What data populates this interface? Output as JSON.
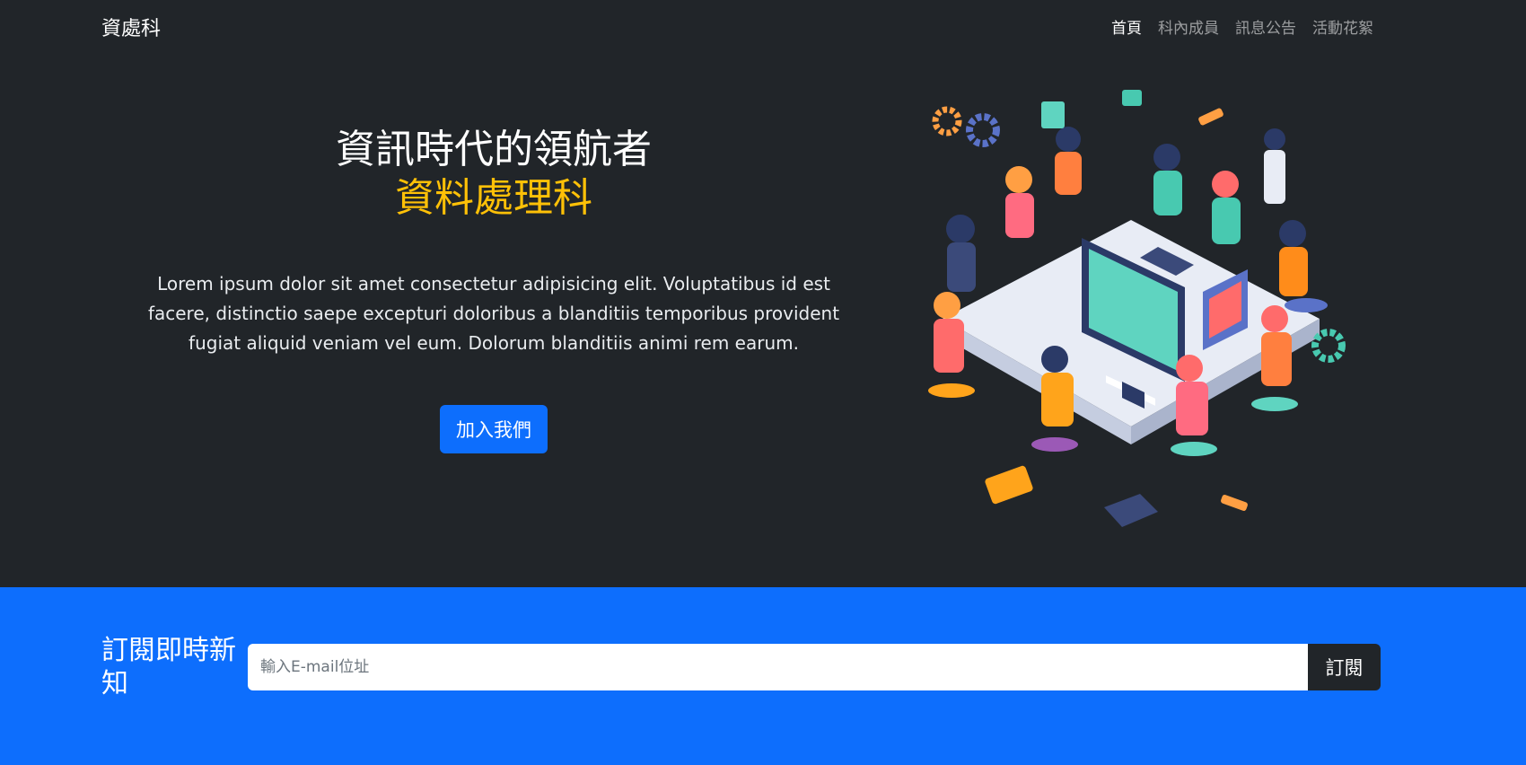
{
  "navbar": {
    "brand": "資處科",
    "links": [
      {
        "label": "首頁",
        "active": true
      },
      {
        "label": "科內成員",
        "active": false
      },
      {
        "label": "訊息公告",
        "active": false
      },
      {
        "label": "活動花絮",
        "active": false
      }
    ]
  },
  "hero": {
    "title_line1": "資訊時代的領航者",
    "title_line2": "資料處理科",
    "description": "Lorem ipsum dolor sit amet consectetur adipisicing elit. Voluptatibus id est facere, distinctio saepe excepturi doloribus a blanditiis temporibus provident fugiat aliquid veniam vel eum. Dolorum blanditiis animi rem earum.",
    "button_label": "加入我們",
    "illustration_icon": "team-computers-illustration"
  },
  "subscribe": {
    "title": "訂閱即時新知",
    "input_placeholder": "輸入E-mail位址",
    "input_value": "",
    "button_label": "訂閱"
  },
  "colors": {
    "dark_bg": "#212529",
    "primary": "#0d6efd",
    "accent_yellow": "#ffc107"
  }
}
